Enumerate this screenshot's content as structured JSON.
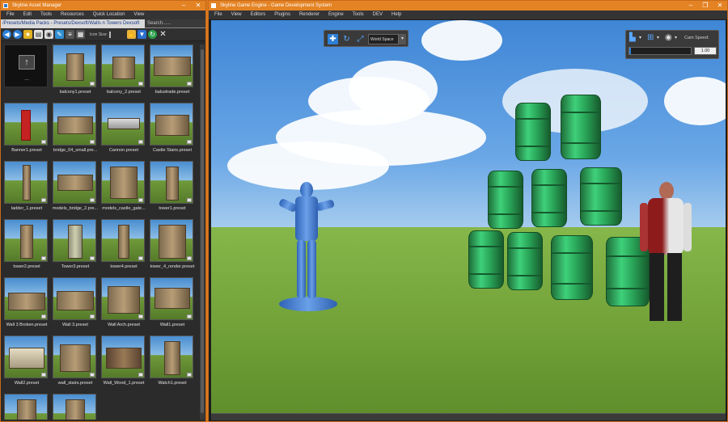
{
  "asset_manager": {
    "title": "Skyline Asset Manager",
    "menu": [
      "File",
      "Edit",
      "Tools",
      "Resources",
      "Quick Location",
      "View"
    ],
    "path": "/Presets/Media Packs - Presets/Dexsoft/Walls n Towers Dexsoft",
    "search_placeholder": "Search......",
    "icon_size_label": "Icon Size:",
    "up_label": "...",
    "items": [
      "balcony1.preset",
      "balcony_2.preset",
      "balustrade.preset",
      "Banner1.preset",
      "bridge_04_small.pre...",
      "Cannon.preset",
      "Castle Stairs.preset",
      "ladder_1.preset",
      "models_bridge_2.pre...",
      "models_castle_gate...",
      "tower1.preset",
      "tower2.preset",
      "Tower3.preset",
      "tower4.preset",
      "tower_4_render.preset",
      "Wall 3 Broken.preset",
      "Wall 3.preset",
      "Wall Arch.preset",
      "Wall1.preset",
      "Wall2.preset",
      "wall_stairs.preset",
      "Wall_Wood_1.preset",
      "Watch1.preset"
    ]
  },
  "game_engine": {
    "title": "Skyline Game Engine - Game Development System",
    "menu": [
      "File",
      "View",
      "Editors",
      "Plugins",
      "Renderer",
      "Engine",
      "Tools",
      "DEV",
      "Help"
    ],
    "transform_space": "World Space",
    "cam_speed_label": "Cam Speed:",
    "cam_speed_value": "1.00",
    "cam_speed_fraction": 0.03
  },
  "colors": {
    "accent": "#e48324",
    "panel": "#2b2b2b"
  }
}
